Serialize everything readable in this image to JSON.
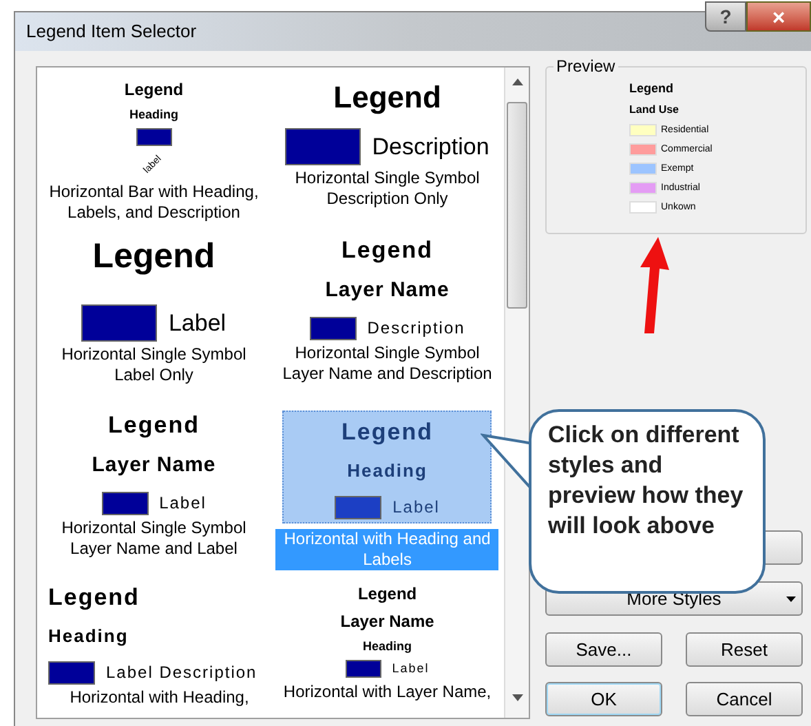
{
  "window": {
    "title": "Legend Item Selector",
    "controls": [
      "?",
      "×"
    ]
  },
  "styles": [
    {
      "selected": false,
      "caption": "Horizontal Bar with Heading, Labels, and Description",
      "parts": [
        {
          "kind": "title-small",
          "text": "Legend"
        },
        {
          "kind": "heading-tiny",
          "text": "Heading"
        },
        {
          "kind": "swatch-small"
        },
        {
          "kind": "rotated-label",
          "text": "label"
        }
      ]
    },
    {
      "selected": false,
      "caption": "Horizontal Single Symbol Description Only",
      "parts": [
        {
          "kind": "title-large",
          "text": "Legend"
        },
        {
          "kind": "swatch-large",
          "text": "Description"
        }
      ]
    },
    {
      "selected": false,
      "caption": "Horizontal Single Symbol Label Only",
      "parts": [
        {
          "kind": "title-xlarge",
          "text": "Legend"
        },
        {
          "kind": "swatch-large",
          "text": "Label"
        }
      ]
    },
    {
      "selected": false,
      "caption": "Horizontal Single Symbol Layer Name and Description",
      "parts": [
        {
          "kind": "title-medium",
          "text": "Legend"
        },
        {
          "kind": "subtitle",
          "text": "Layer Name"
        },
        {
          "kind": "swatch-medium",
          "text": "Description"
        }
      ]
    },
    {
      "selected": false,
      "caption": "Horizontal Single Symbol Layer Name and Label",
      "parts": [
        {
          "kind": "title-medium",
          "text": "Legend"
        },
        {
          "kind": "subtitle",
          "text": "Layer Name"
        },
        {
          "kind": "swatch-medium",
          "text": "Label"
        }
      ]
    },
    {
      "selected": true,
      "caption": "Horizontal with Heading and Labels",
      "parts": [
        {
          "kind": "title-medium",
          "text": "Legend"
        },
        {
          "kind": "heading",
          "text": "Heading"
        },
        {
          "kind": "swatch-medium",
          "text": "Label"
        }
      ]
    },
    {
      "selected": false,
      "caption": "Horizontal with Heading,",
      "parts": [
        {
          "kind": "title-medium",
          "text": "Legend"
        },
        {
          "kind": "heading",
          "text": "Heading"
        },
        {
          "kind": "swatch-medium",
          "text": "Label Description"
        }
      ]
    },
    {
      "selected": false,
      "caption": "Horizontal with Layer Name,",
      "parts": [
        {
          "kind": "title-small",
          "text": "Legend"
        },
        {
          "kind": "heading-small",
          "text": "Layer Name"
        },
        {
          "kind": "heading-tiny",
          "text": "Heading"
        },
        {
          "kind": "swatch-small",
          "text": "Label"
        }
      ]
    }
  ],
  "preview": {
    "label": "Preview",
    "title": "Legend",
    "layer": "Land Use",
    "classes": [
      {
        "text": "Residential",
        "color": "#ffffc0"
      },
      {
        "text": "Commercial",
        "color": "#ff9c9c"
      },
      {
        "text": "Exempt",
        "color": "#9cc4ff"
      },
      {
        "text": "Industrial",
        "color": "#e49cf4"
      },
      {
        "text": "Unkown",
        "color": "#ffffff"
      }
    ]
  },
  "callout": {
    "text": "Click on different styles and preview how they will look above"
  },
  "buttons": {
    "more_styles": "More Styles",
    "save": "Save...",
    "reset": "Reset",
    "ok": "OK",
    "cancel": "Cancel"
  }
}
